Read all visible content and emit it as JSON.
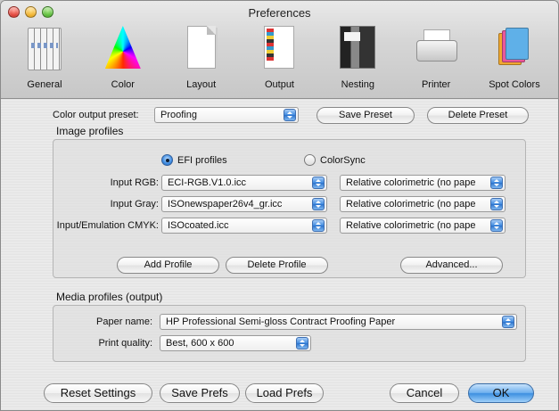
{
  "window": {
    "title": "Preferences"
  },
  "toolbar": {
    "items": [
      {
        "label": "General",
        "icon": "general-sliders-icon"
      },
      {
        "label": "Color",
        "icon": "color-gamut-icon"
      },
      {
        "label": "Layout",
        "icon": "layout-page-icon"
      },
      {
        "label": "Output",
        "icon": "output-page-icon"
      },
      {
        "label": "Nesting",
        "icon": "nesting-images-icon"
      },
      {
        "label": "Printer",
        "icon": "printer-icon"
      },
      {
        "label": "Spot Colors",
        "icon": "spot-colors-icon"
      }
    ]
  },
  "color_output": {
    "preset_label": "Color output preset:",
    "preset_value": "Proofing",
    "save_preset": "Save Preset",
    "delete_preset": "Delete Preset"
  },
  "image_profiles": {
    "title": "Image profiles",
    "radio_efi": "EFI profiles",
    "radio_colorsync": "ColorSync",
    "selected": "EFI profiles",
    "rows": [
      {
        "label": "Input RGB:",
        "profile": "ECI-RGB.V1.0.icc",
        "intent": "Relative colorimetric (no pape"
      },
      {
        "label": "Input Gray:",
        "profile": "ISOnewspaper26v4_gr.icc",
        "intent": "Relative colorimetric (no pape"
      },
      {
        "label": "Input/Emulation CMYK:",
        "profile": "ISOcoated.icc",
        "intent": "Relative colorimetric (no pape"
      }
    ],
    "add_profile": "Add Profile",
    "delete_profile": "Delete Profile",
    "advanced": "Advanced..."
  },
  "media_profiles": {
    "title": "Media profiles (output)",
    "paper_label": "Paper name:",
    "paper_value": "HP Professional Semi-gloss Contract Proofing Paper",
    "quality_label": "Print quality:",
    "quality_value": "Best, 600 x 600"
  },
  "footer": {
    "reset": "Reset Settings",
    "save_prefs": "Save Prefs",
    "load_prefs": "Load Prefs",
    "cancel": "Cancel",
    "ok": "OK"
  },
  "colors": {
    "accent": "#3d8fe0",
    "window_bg": "#ececec"
  }
}
